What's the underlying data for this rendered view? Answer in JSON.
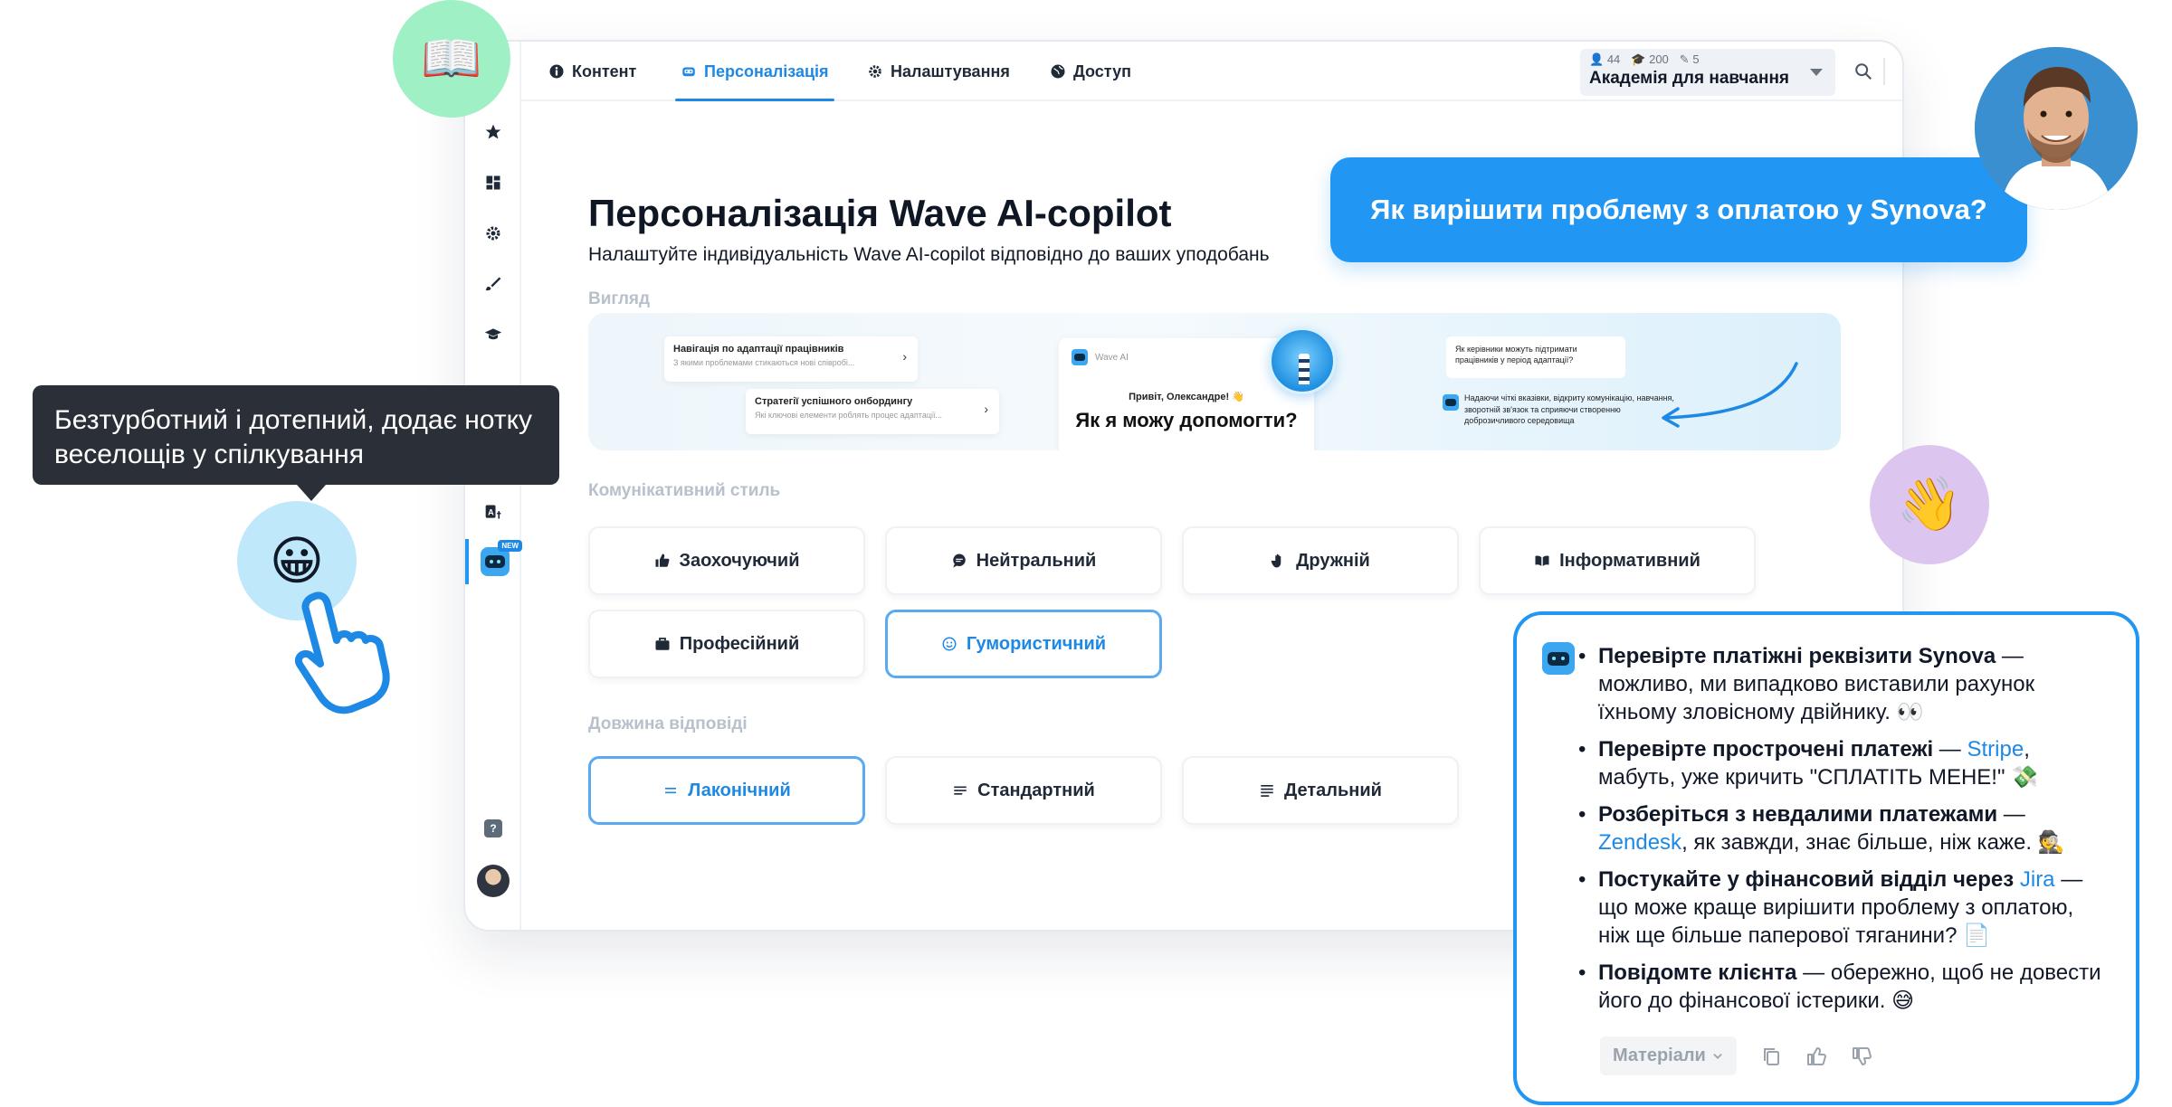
{
  "nav": {
    "tabs": [
      {
        "label": "Контент",
        "icon": "info-icon"
      },
      {
        "label": "Персоналізація",
        "icon": "bot-icon",
        "active": true
      },
      {
        "label": "Налаштування",
        "icon": "gear-icon"
      },
      {
        "label": "Доступ",
        "icon": "globe-icon"
      }
    ],
    "academy": {
      "users": "44",
      "courses": "200",
      "editors": "5",
      "name": "Академія для навчання"
    }
  },
  "sidebar": {
    "new_badge": "NEW",
    "help": "?"
  },
  "page": {
    "title": "Персоналізація Wave AI-copilot",
    "subtitle": "Налаштуйте індивідуальність Wave AI-copilot відповідно до ваших уподобань"
  },
  "sections": {
    "view_label": "Вигляд",
    "style_label": "Комунікативний стиль",
    "length_label": "Довжина відповіді"
  },
  "preview": {
    "card1_title": "Навігація по адаптації працівників",
    "card1_sub": "З якими проблемами стикаються нові співробі...",
    "card2_title": "Стратегії успішного онбордингу",
    "card2_sub": "Які ключові елементи роблять процес адаптації...",
    "brand": "Wave AI",
    "greeting": "Привіт, Олександре! 👋",
    "question": "Як я можу допомогти?",
    "user_q": "Як керівники можуть підтримати працівників у період адаптації?",
    "answer": "Надаючи чіткі вказівки, відкриту комунікацію, навчання, зворотній зв'язок та сприяючи створенню доброзичливого середовища"
  },
  "styles": [
    {
      "label": "Заохочуючий",
      "icon": "thumbs-up-icon",
      "selected": false
    },
    {
      "label": "Нейтральний",
      "icon": "chat-icon",
      "selected": false
    },
    {
      "label": "Дружній",
      "icon": "wave-hand-icon",
      "selected": false
    },
    {
      "label": "Інформативний",
      "icon": "book-icon",
      "selected": false
    },
    {
      "label": "Професійний",
      "icon": "briefcase-icon",
      "selected": false
    },
    {
      "label": "Гумористичний",
      "icon": "smile-icon",
      "selected": true
    }
  ],
  "lengths": [
    {
      "label": "Лаконічний",
      "icon": "short-lines-icon",
      "selected": true
    },
    {
      "label": "Стандартний",
      "icon": "lines-icon",
      "selected": false
    },
    {
      "label": "Детальний",
      "icon": "many-lines-icon",
      "selected": false
    }
  ],
  "tooltip": {
    "text": "Безтурботний і дотепний, додає нотку веселощів у спілкування"
  },
  "emoji": {
    "book": "📖",
    "smile": "😀",
    "wave": "👋"
  },
  "chat": {
    "question": "Як вирішити проблему з оплатою у Synova?",
    "items": [
      {
        "bold": "Перевірте платіжні реквізити Synova",
        "pre": "",
        "link": "",
        "text": " — можливо, ми випадково виставили рахунок їхньому зловісному двійнику. 👀"
      },
      {
        "bold": "Перевірте прострочені платежі",
        "pre": " — ",
        "link": "Stripe",
        "text": ", мабуть, уже кричить \"СПЛАТІТЬ МЕНЕ!\" 💸"
      },
      {
        "bold": "Розберіться з невдалими платежами",
        "pre": " — ",
        "link": "Zendesk",
        "text": ", як завжди, знає більше, ніж каже. 🕵"
      },
      {
        "bold": "Постукайте у фінансовий відділ через",
        "pre": " ",
        "link": "Jira",
        "text": " — що може краще вирішити проблему з оплатою, ніж ще більше паперової тяганини? 📄"
      },
      {
        "bold": "Повідомте клієнта",
        "pre": "",
        "link": "",
        "text": " — обережно, щоб не довести його до фінансової істерики. 😅"
      }
    ],
    "materials_label": "Матеріали"
  },
  "colors": {
    "accent": "#2196f3",
    "dark_tooltip": "#2b3038",
    "book_bubble": "#9ff0c4",
    "smile_bubble": "#bfe8fb",
    "wave_bubble": "#dcc6f0"
  }
}
